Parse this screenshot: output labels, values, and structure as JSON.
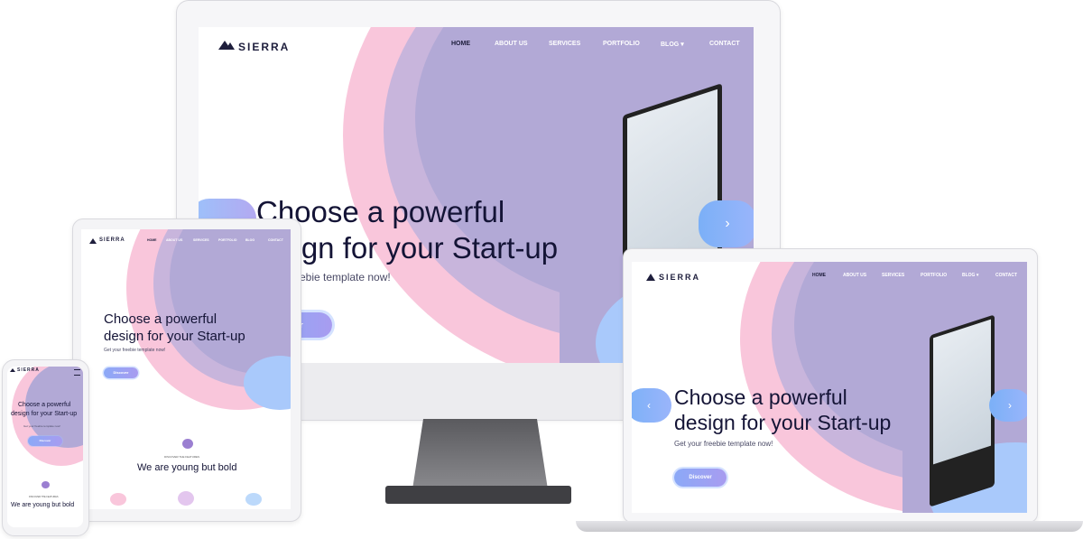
{
  "brand": {
    "name": "SIERRA"
  },
  "nav": {
    "items": [
      "HOME",
      "ABOUT US",
      "SERVICES",
      "PORTFOLIO",
      "BLOG",
      "CONTACT"
    ],
    "blog_caret": "▾"
  },
  "hero": {
    "title_line1": "Choose a powerful",
    "title_line2": "design for your Start-up",
    "title_line1_partial": "Choose a powerful",
    "title_line2_partial": "sign for your Start-up",
    "subtitle": "Get your freebie template now!",
    "subtitle_partial": "freebie template now!",
    "button": "Discover",
    "button_partial": "ver",
    "arrow_left": "‹",
    "arrow_right": "›"
  },
  "features": {
    "kicker": "DISCOVER THE FEATURES",
    "heading": "We are young but bold"
  },
  "colors": {
    "pink": "#f9c6db",
    "lavender": "#b2a9d6",
    "blue_accent": "#9bc3fb",
    "button_gradient_start": "#8ba9f7",
    "button_gradient_end": "#a89cf0"
  }
}
